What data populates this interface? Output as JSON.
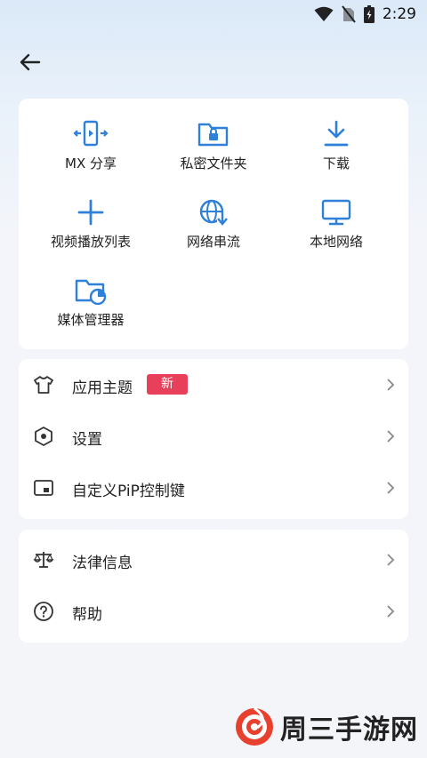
{
  "status": {
    "time": "2:29"
  },
  "grid": [
    {
      "label": "MX 分享",
      "icon": "mx-share-icon"
    },
    {
      "label": "私密文件夹",
      "icon": "private-folder-icon"
    },
    {
      "label": "下载",
      "icon": "download-icon"
    },
    {
      "label": "视频播放列表",
      "icon": "add-icon"
    },
    {
      "label": "网络串流",
      "icon": "network-stream-icon"
    },
    {
      "label": "本地网络",
      "icon": "monitor-icon"
    },
    {
      "label": "媒体管理器",
      "icon": "media-folder-icon"
    }
  ],
  "menu1": [
    {
      "label": "应用主题",
      "badge": "新",
      "icon": "shirt-icon"
    },
    {
      "label": "设置",
      "icon": "hexagon-settings-icon"
    },
    {
      "label": "自定义PiP控制键",
      "icon": "pip-icon"
    }
  ],
  "menu2": [
    {
      "label": "法律信息",
      "icon": "scale-icon"
    },
    {
      "label": "帮助",
      "icon": "help-icon"
    }
  ],
  "watermark": {
    "text": "周三手游网"
  },
  "colors": {
    "accent": "#2f80d9",
    "badge": "#e8405a",
    "icon_gray": "#333333"
  }
}
